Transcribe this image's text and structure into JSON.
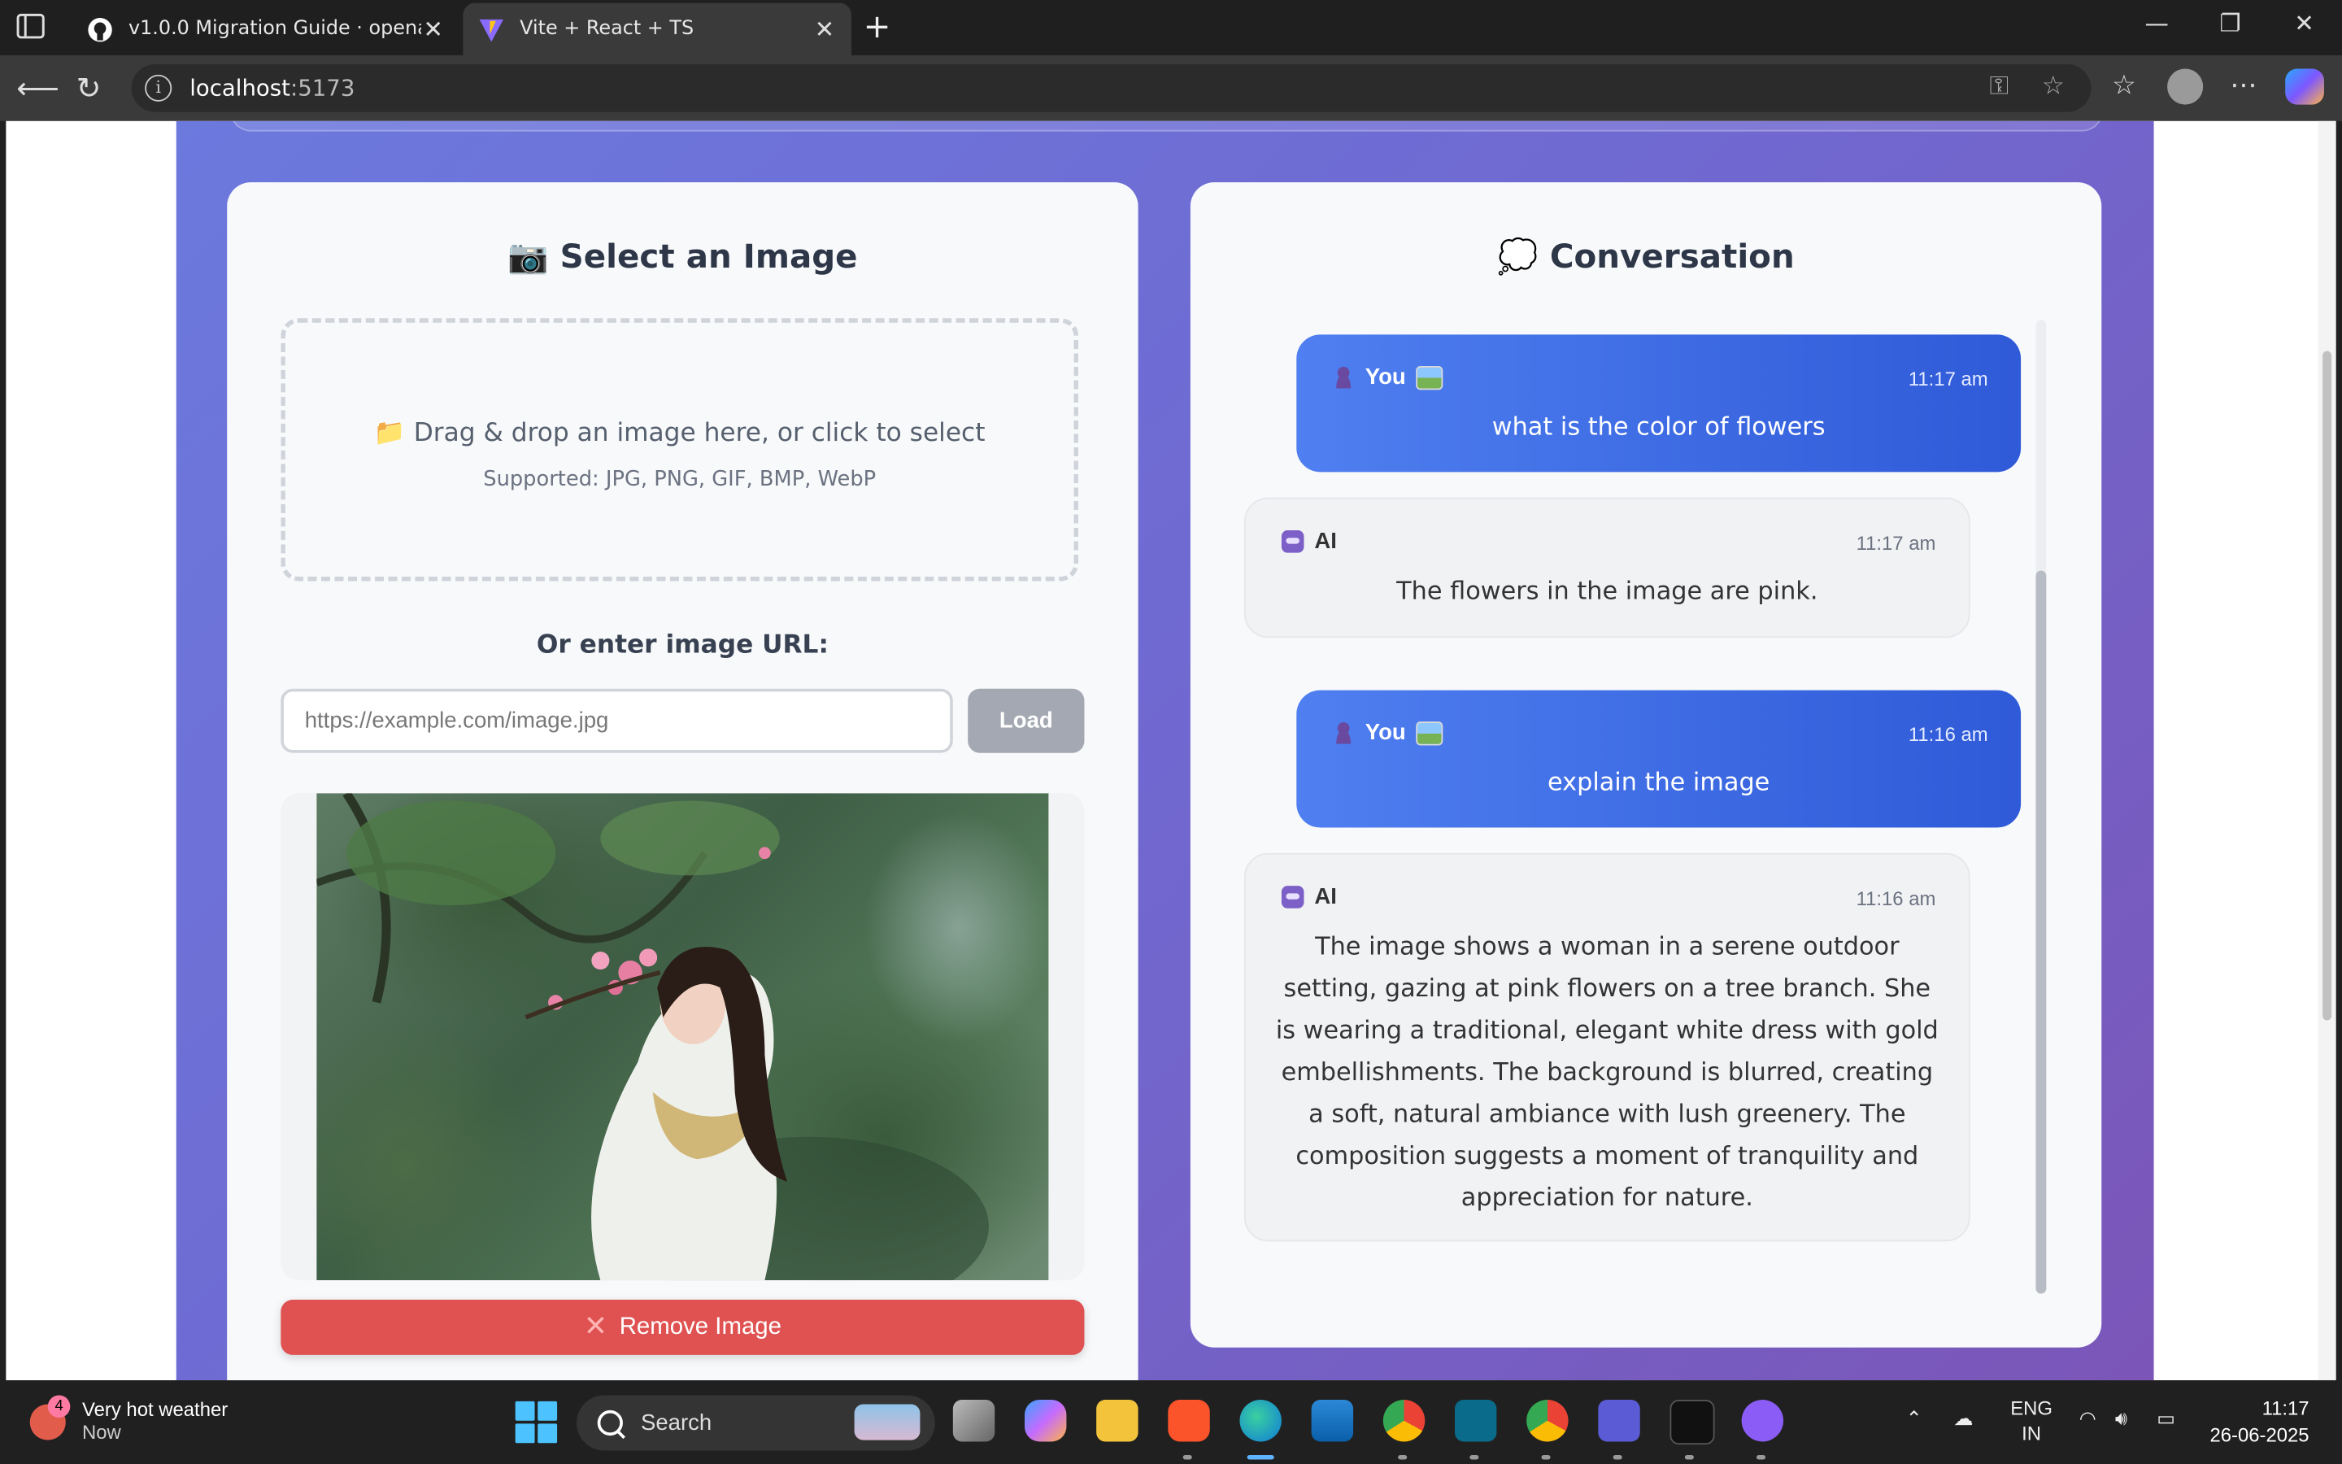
{
  "browser": {
    "tabs": [
      {
        "title": "v1.0.0 Migration Guide · openai/o",
        "icon": "github-icon",
        "active": false
      },
      {
        "title": "Vite + React + TS",
        "icon": "vite-icon",
        "active": true
      }
    ],
    "new_tab_label": "+",
    "address": {
      "host": "localhost",
      "port": ":5173"
    }
  },
  "image_panel": {
    "title_icon": "📷",
    "title": "Select an Image",
    "dropzone_icon": "📁",
    "dropzone_text": "Drag & drop an image here, or click to select",
    "dropzone_formats": "Supported: JPG, PNG, GIF, BMP, WebP",
    "url_label": "Or enter image URL:",
    "url_placeholder": "https://example.com/image.jpg",
    "url_value": "",
    "load_label": "Load",
    "remove_icon": "✕",
    "remove_label": "Remove Image"
  },
  "chat": {
    "title_icon": "💭",
    "title": "Conversation",
    "messages": [
      {
        "role": "user",
        "sender": "You",
        "time": "11:17 am",
        "text": "what is the color of flowers"
      },
      {
        "role": "ai",
        "sender": "AI",
        "time": "11:17 am",
        "text": "The flowers in the image are pink."
      },
      {
        "role": "user",
        "sender": "You",
        "time": "11:16 am",
        "text": "explain the image"
      },
      {
        "role": "ai",
        "sender": "AI",
        "time": "11:16 am",
        "text": "The image shows a woman in a serene outdoor setting, gazing at pink flowers on a tree branch. She is wearing a traditional, elegant white dress with gold embellishments. The background is blurred, creating a soft, natural ambiance with lush greenery. The composition suggests a moment of tranquility and appreciation for nature."
      }
    ]
  },
  "taskbar": {
    "weather": {
      "badge": "4",
      "title": "Very hot weather",
      "subtitle": "Now"
    },
    "search_label": "Search",
    "language": {
      "line1": "ENG",
      "line2": "IN"
    },
    "time": "11:17",
    "date": "26-06-2025"
  },
  "colors": {
    "page_gradient_start": "#6c79dd",
    "page_gradient_end": "#7b56b8",
    "user_bubble": "#3b68e0",
    "remove_button": "#e05252",
    "load_button": "#a3a8b2"
  }
}
